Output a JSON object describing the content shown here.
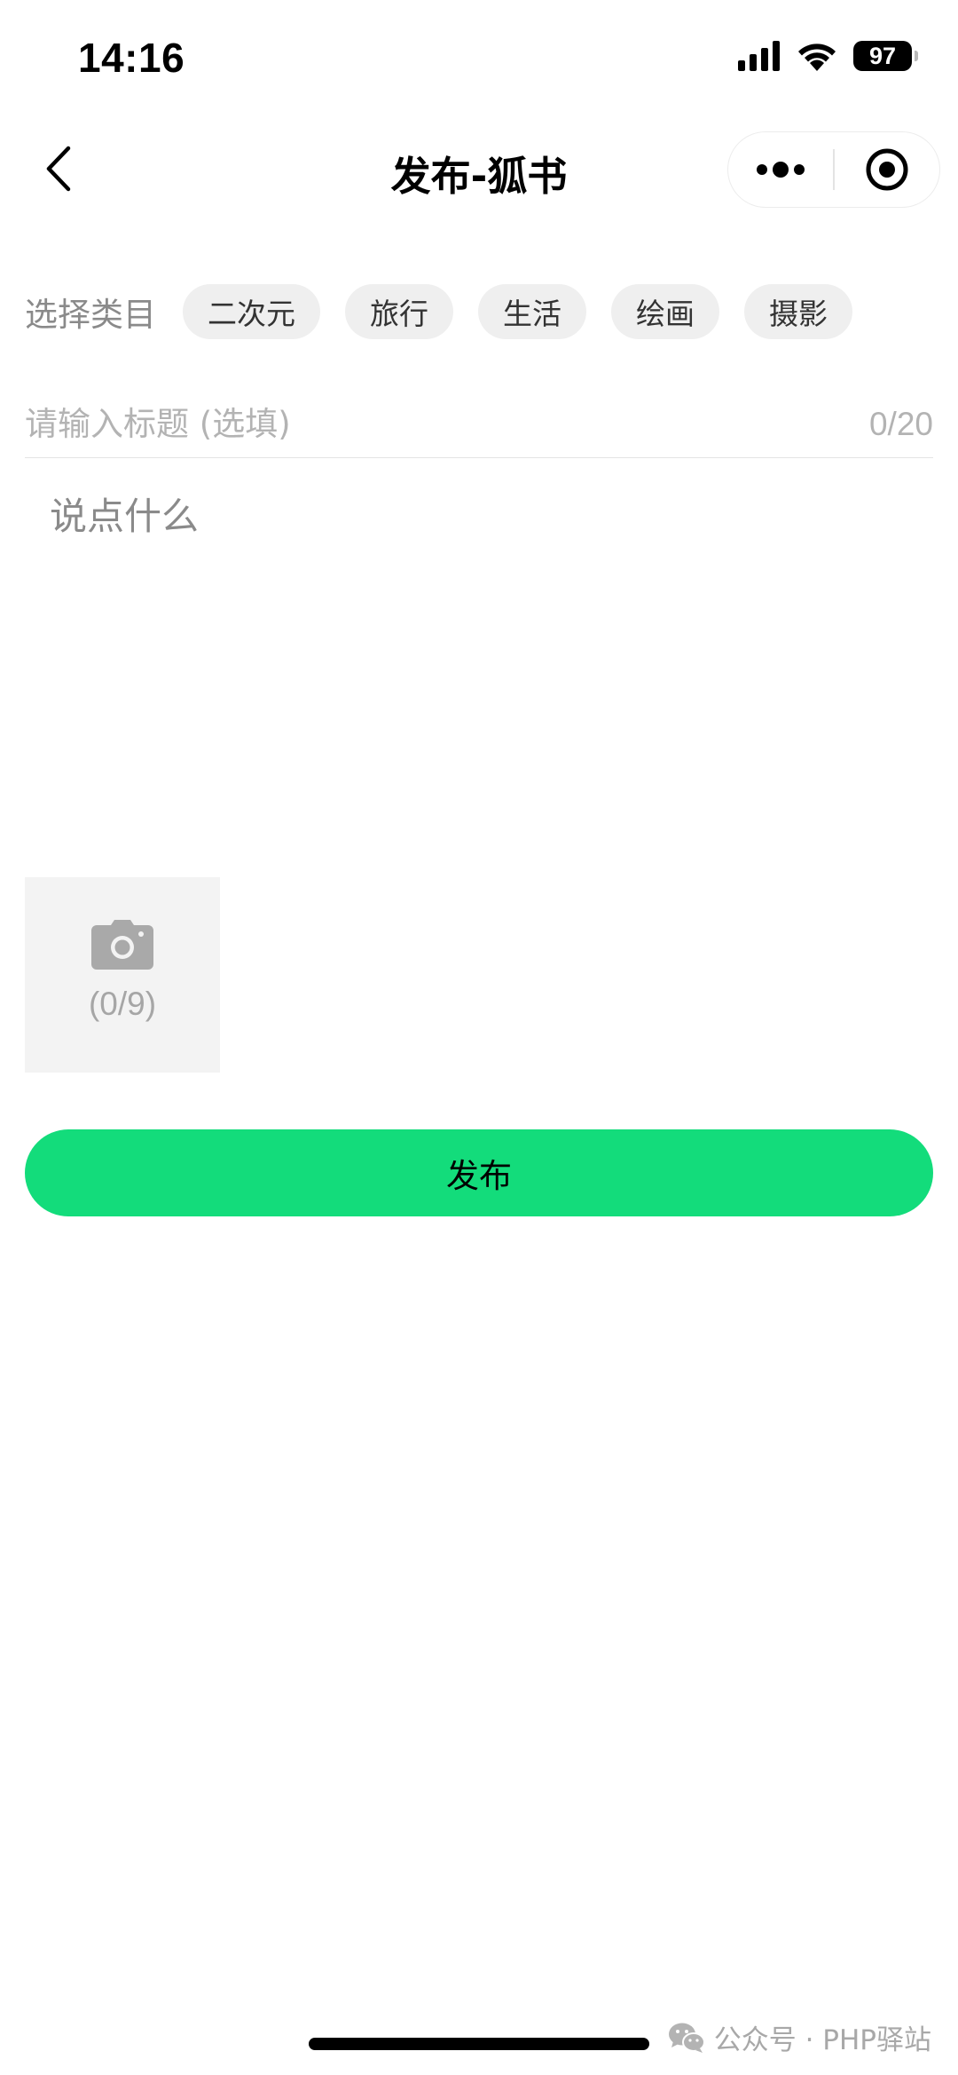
{
  "status_bar": {
    "time": "14:16",
    "battery": "97"
  },
  "nav": {
    "title": "发布-狐书"
  },
  "category": {
    "label": "选择类目",
    "options": [
      "二次元",
      "旅行",
      "生活",
      "绘画",
      "摄影"
    ]
  },
  "title_field": {
    "placeholder": "请输入标题 (选填)",
    "value": "",
    "counter": "0/20"
  },
  "content_field": {
    "placeholder": "说点什么",
    "value": ""
  },
  "upload": {
    "count": "(0/9)"
  },
  "publish": {
    "label": "发布",
    "color": "#13dc7b"
  },
  "watermark": {
    "text": "公众号 · PHP驿站"
  },
  "icons": {
    "back": "chevron-left-icon",
    "more": "more-dots-icon",
    "target": "target-icon",
    "camera": "camera-icon",
    "wechat": "wechat-icon"
  }
}
